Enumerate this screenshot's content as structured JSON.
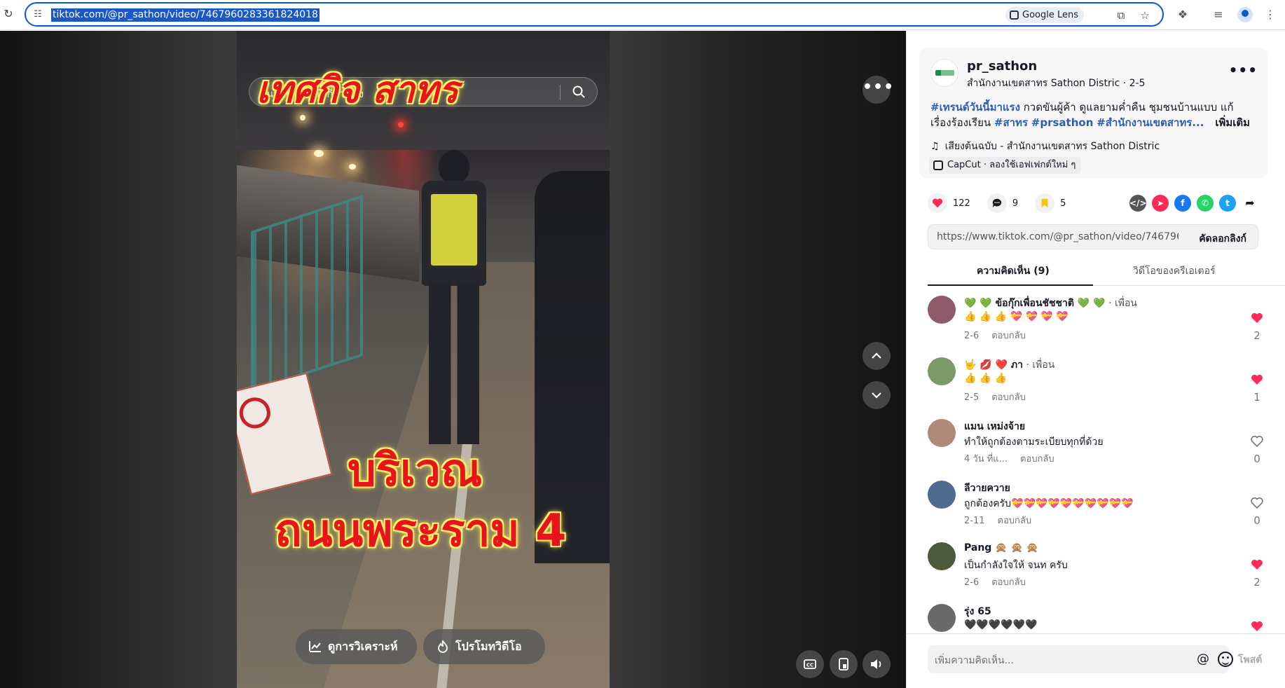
{
  "browser": {
    "url": "tiktok.com/@pr_sathon/video/7467960283361824018",
    "lens_label": "Google Lens"
  },
  "video": {
    "search_placeholder": "ค้นหาเนื้อหาที่เกี่ยวข้อง",
    "overlay_title": "เทศกิจ สาทร",
    "overlay_line2": "บริเวณ",
    "overlay_line3": "ถนนพระราม 4",
    "analytics_label": "ดูการวิเคราะห์",
    "promote_label": "โปรโมทวิดีโอ"
  },
  "creator": {
    "username": "pr_sathon",
    "display_name": "สำนักงานเขตสาทร Sathon Distric",
    "date": "2-5",
    "subtitle": "สำนักงานเขตสาทร Sathon Distric · 2-5"
  },
  "description": {
    "tag1": "#เทรนด์วันนี้มาแรง",
    "text1": " กวดขันผู้ค้า ดูแลยามค่ำคืน ชุมชนบ้านแบบ แก้เรื่องร้องเรียน ",
    "tag2": "#สาทร",
    "tag3": "#prsathon",
    "tag4": "#สำนักงานเขตสาทร...",
    "more_label": "เพิ่มเติม"
  },
  "music": "เสียงต้นฉบับ - สำนักงานเขตสาทร Sathon Distric",
  "capcut": "CapCut · ลองใช้เอฟเฟกต์ใหม่ ๆ",
  "stats": {
    "likes": "122",
    "comments": "9",
    "saves": "5"
  },
  "share_link": {
    "url": "https://www.tiktok.com/@pr_sathon/video/7467960...",
    "copy_label": "คัดลอกลิงก์"
  },
  "tabs": {
    "comments": "ความคิดเห็น (9)",
    "creator_videos": "วิดีโอของครีเอเตอร์"
  },
  "comments": [
    {
      "name": "💚 💚 ข้อกุ๊กเพื่อนชัชชาติ 💚 💚",
      "friend": " · เพื่อน",
      "text": "👍 👍 👍 💝 💝 💝 💝",
      "date": "2-6",
      "reply": "ตอบกลับ",
      "likes": "2",
      "liked": true,
      "avatar_color": "#8f5a6a"
    },
    {
      "name": "🤟 💋 ❤️ ภา",
      "friend": " · เพื่อน",
      "text": "👍 👍 👍",
      "date": "2-5",
      "reply": "ตอบกลับ",
      "likes": "1",
      "liked": true,
      "avatar_color": "#7a9a6a"
    },
    {
      "name": "แมน เหม่งจ้าย",
      "friend": "",
      "text": "ทำให้ถูกต้องตามระเบียบทุกที่ด้วย",
      "date": "4 วัน ที่แ...",
      "reply": "ตอบกลับ",
      "likes": "0",
      "liked": false,
      "avatar_color": "#b08878"
    },
    {
      "name": "ลีวายควาย",
      "friend": "",
      "text": "ถูกต้องครับ💝💝💝💝💝💝💝💝💝💝",
      "date": "2-11",
      "reply": "ตอบกลับ",
      "likes": "0",
      "liked": false,
      "avatar_color": "#4f6a8f"
    },
    {
      "name": "Pang 🙊 🙊 🙊",
      "friend": "",
      "text": "เป็นกำลังใจให้ จนท ครับ",
      "date": "2-6",
      "reply": "ตอบกลับ",
      "likes": "2",
      "liked": true,
      "avatar_color": "#4a5a3a"
    },
    {
      "name": "รุ่ง 65",
      "friend": "",
      "text": "🖤🖤🖤🖤🖤🖤",
      "date": "",
      "reply": "",
      "likes": "",
      "liked": true,
      "avatar_color": "#6a6a6a"
    }
  ],
  "comment_input": {
    "placeholder": "เพิ่มความคิดเห็น...",
    "post_label": "โพสต์"
  },
  "colors": {
    "accent": "#fe2c55",
    "link_blue": "#2b5db9",
    "omnibox_border": "#0b57d0"
  }
}
